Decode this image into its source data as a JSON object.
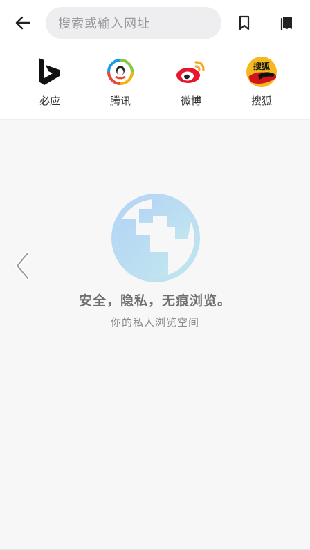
{
  "toolbar": {
    "back_icon": "arrow-left-icon",
    "search_placeholder": "搜索或输入网址",
    "bookmark_icon": "bookmark-icon",
    "bookmarks_icon": "bookmarks-stack-icon"
  },
  "shortcuts": [
    {
      "label": "必应",
      "icon": "bing-logo-icon",
      "color": "#111111"
    },
    {
      "label": "腾讯",
      "icon": "tencent-logo-icon",
      "color": "#1e9be8"
    },
    {
      "label": "微博",
      "icon": "weibo-logo-icon",
      "color": "#e6162d"
    },
    {
      "label": "搜狐",
      "icon": "sohu-logo-icon",
      "color": "#f5b920"
    }
  ],
  "private_mode": {
    "headline": "安全，隐私，无痕浏览。",
    "subline": "你的私人浏览空间",
    "globe_color": "#b8daf4"
  },
  "nav": {
    "left_arrow_icon": "chevron-left-icon"
  },
  "sohu_logo_text": "搜狐"
}
